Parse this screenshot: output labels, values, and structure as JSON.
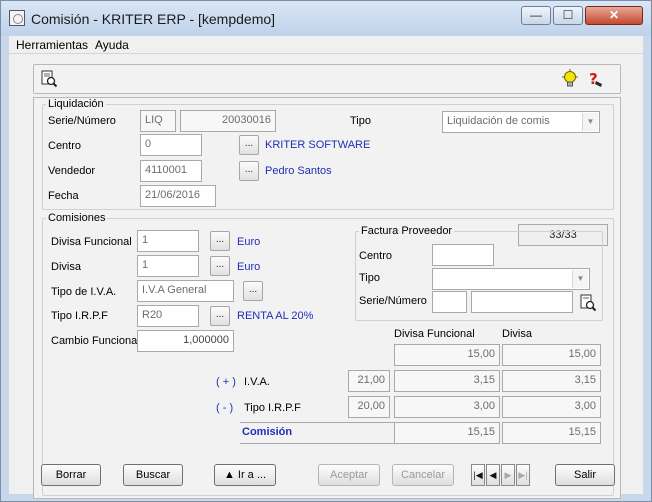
{
  "window": {
    "title": "Comisión - KRITER ERP - [kempdemo]",
    "min_glyph": "—",
    "max_glyph": "☐",
    "close_glyph": "✕"
  },
  "menu": {
    "items": [
      "Herramientas",
      "Ayuda"
    ]
  },
  "toolbar": {
    "icons": [
      "preview-icon",
      "lightbulb-icon",
      "help-icon"
    ]
  },
  "liquidacion": {
    "title": "Liquidación",
    "serie_numero_label": "Serie/Número",
    "serie": "LIQ",
    "numero": "20030016",
    "tipo_label": "Tipo",
    "tipo_value": "Liquidación de comis",
    "centro_label": "Centro",
    "centro_value": "0",
    "centro_desc": "KRITER SOFTWARE",
    "vendedor_label": "Vendedor",
    "vendedor_value": "4110001",
    "vendedor_desc": "Pedro Santos",
    "fecha_label": "Fecha",
    "fecha_value": "21/06/2016",
    "counter": "33/33"
  },
  "comisiones": {
    "title": "Comisiones",
    "divisa_funcional_label": "Divisa Funcional",
    "divisa_funcional_value": "1",
    "divisa_funcional_desc": "Euro",
    "divisa_label": "Divisa",
    "divisa_value": "1",
    "divisa_desc": "Euro",
    "tipo_iva_label": "Tipo de I.V.A.",
    "tipo_iva_value": "I.V.A General",
    "tipo_irpf_label": "Tipo I.R.P.F",
    "tipo_irpf_value": "R20",
    "tipo_irpf_desc": "RENTA AL 20%",
    "cambio_label": "Cambio Funcional",
    "cambio_value": "1,000000",
    "dots": "...",
    "factura": {
      "title": "Factura Proveedor",
      "centro_label": "Centro",
      "tipo_label": "Tipo",
      "serie_label": "Serie/Número"
    },
    "col_divisa_funcional": "Divisa Funcional",
    "col_divisa": "Divisa",
    "base_funcional": "15,00",
    "base_divisa": "15,00",
    "iva_sign": "( + )",
    "iva_label": "I.V.A.",
    "iva_pct": "21,00",
    "iva_funcional": "3,15",
    "iva_divisa": "3,15",
    "irpf_sign": "( - )",
    "irpf_label": "Tipo I.R.P.F",
    "irpf_pct": "20,00",
    "irpf_funcional": "3,00",
    "irpf_divisa": "3,00",
    "total_label": "Comisión",
    "total_funcional": "15,15",
    "total_divisa": "15,15"
  },
  "buttons": {
    "borrar": "Borrar",
    "buscar": "Buscar",
    "ir_a": "Ir a ...",
    "aceptar": "Aceptar",
    "cancelar": "Cancelar",
    "salir": "Salir"
  },
  "navigation": {
    "first": "|◀",
    "prev": "◀",
    "next": "▶",
    "last": "▶|"
  }
}
